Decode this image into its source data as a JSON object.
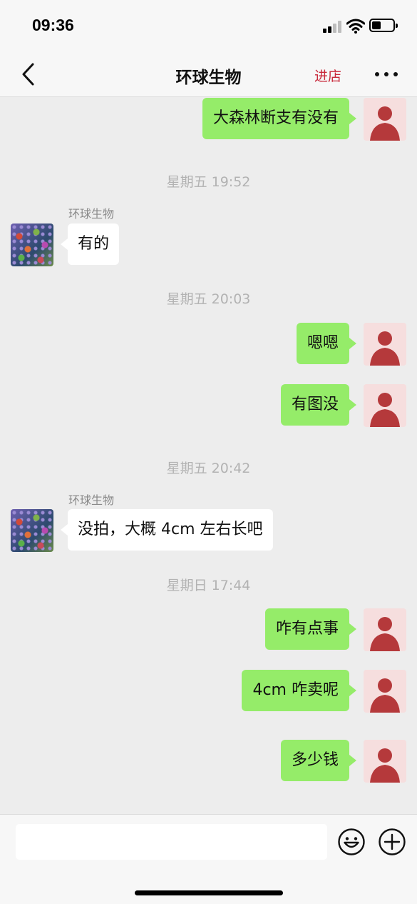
{
  "status_bar": {
    "time": "09:36"
  },
  "nav": {
    "title": "环球生物",
    "enter_shop_label": "进店"
  },
  "chat": {
    "messages": [
      {
        "type": "outgoing",
        "text": "大森林断支有没有"
      },
      {
        "type": "timestamp",
        "text": "星期五 19:52"
      },
      {
        "type": "incoming",
        "sender": "环球生物",
        "text": "有的"
      },
      {
        "type": "timestamp",
        "text": "星期五 20:03"
      },
      {
        "type": "outgoing",
        "text": "嗯嗯"
      },
      {
        "type": "outgoing",
        "text": "有图没"
      },
      {
        "type": "timestamp",
        "text": "星期五 20:42"
      },
      {
        "type": "incoming",
        "sender": "环球生物",
        "text": "没拍，大概 4cm 左右长吧"
      },
      {
        "type": "timestamp",
        "text": "星期日 17:44"
      },
      {
        "type": "outgoing",
        "text": "咋有点事"
      },
      {
        "type": "outgoing",
        "text": "4cm 咋卖呢"
      },
      {
        "type": "outgoing",
        "text": "多少钱"
      }
    ]
  },
  "input": {
    "placeholder": ""
  },
  "icons": {
    "back": "chevron-left-icon",
    "more": "more-dots-icon",
    "user_avatar": "default-user-icon",
    "emoji": "smiley-icon",
    "add": "plus-circle-icon"
  },
  "colors": {
    "outgoing_bubble": "#95ec69",
    "incoming_bubble": "#ffffff",
    "accent_red": "#c8283a",
    "chat_background": "#ededed",
    "user_avatar_bg": "#f6dede",
    "user_avatar_fg": "#b5393b"
  }
}
